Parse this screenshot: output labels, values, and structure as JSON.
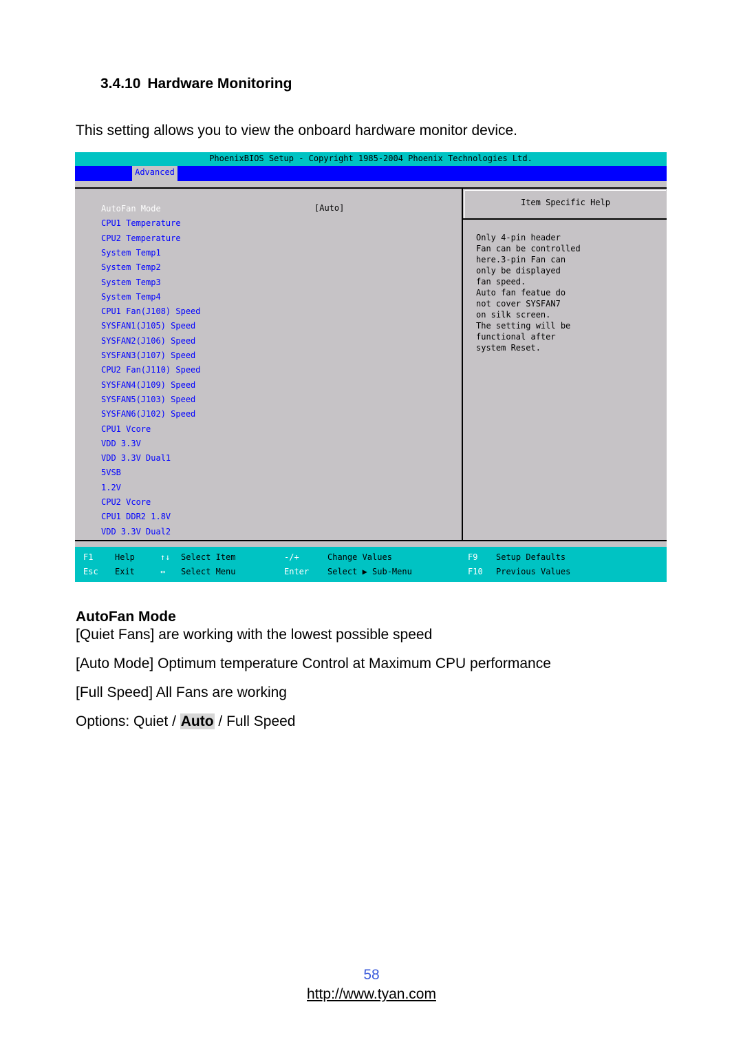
{
  "document": {
    "section_number": "3.4.10",
    "section_title": "Hardware Monitoring",
    "intro": "This setting allows you to view the onboard hardware monitor device."
  },
  "bios": {
    "title": "PhoenixBIOS Setup - Copyright 1985-2004 Phoenix Technologies Ltd.",
    "active_tab": "Advanced",
    "colors": {
      "title_bar": "#00c3c3",
      "menu_bar": "#0000ff",
      "panel": "#c6c3c6",
      "item_text": "#0000ff",
      "selected_text": "#ffffff"
    },
    "items": [
      {
        "label": "AutoFan Mode",
        "value": "[Auto]",
        "selected": true
      },
      {
        "label": "CPU1 Temperature"
      },
      {
        "label": "CPU2 Temperature"
      },
      {
        "label": "System Temp1"
      },
      {
        "label": "System Temp2"
      },
      {
        "label": "System Temp3"
      },
      {
        "label": "System Temp4"
      },
      {
        "label": "CPU1 Fan(J108) Speed"
      },
      {
        "label": "SYSFAN1(J105) Speed"
      },
      {
        "label": "SYSFAN2(J106) Speed"
      },
      {
        "label": "SYSFAN3(J107) Speed"
      },
      {
        "label": "CPU2 Fan(J110) Speed"
      },
      {
        "label": "SYSFAN4(J109) Speed"
      },
      {
        "label": "SYSFAN5(J103) Speed"
      },
      {
        "label": "SYSFAN6(J102) Speed"
      },
      {
        "label": "CPU1 Vcore"
      },
      {
        "label": "VDD 3.3V"
      },
      {
        "label": "VDD 3.3V Dual1"
      },
      {
        "label": "5VSB"
      },
      {
        "label": "1.2V"
      },
      {
        "label": "CPU2 Vcore"
      },
      {
        "label": "CPU1 DDR2 1.8V"
      },
      {
        "label": "VDD 3.3V Dual2"
      }
    ],
    "help": {
      "title": "Item Specific Help",
      "lines": [
        "Only 4-pin header",
        "Fan can be controlled",
        "here.3-pin Fan can",
        "only be displayed",
        "fan speed.",
        "Auto fan featue do",
        "not cover SYSFAN7",
        "on silk screen.",
        "The setting will be",
        "functional after",
        "system Reset."
      ]
    },
    "footer": [
      {
        "key": "F1",
        "desc": "Help"
      },
      {
        "key": "Esc",
        "desc": "Exit"
      },
      {
        "key": "↑↓",
        "desc": "Select Item"
      },
      {
        "key": "↔",
        "desc": "Select Menu"
      },
      {
        "key": "-/+",
        "desc": "Change Values"
      },
      {
        "key": "Enter",
        "desc": "Select ▶ Sub-Menu"
      },
      {
        "key": "F9",
        "desc": "Setup Defaults"
      },
      {
        "key": "F10",
        "desc": "Previous Values"
      }
    ]
  },
  "autofan": {
    "heading": "AutoFan Mode",
    "lines": [
      "[Quiet Fans] are working with the lowest possible speed",
      "[Auto Mode] Optimum temperature Control at Maximum CPU performance",
      "[Full Speed] All Fans are working"
    ],
    "options_prefix": "Options: Quiet / ",
    "options_default": "Auto",
    "options_suffix": " / Full Speed"
  },
  "page": {
    "number": "58",
    "url": "http://www.tyan.com"
  }
}
